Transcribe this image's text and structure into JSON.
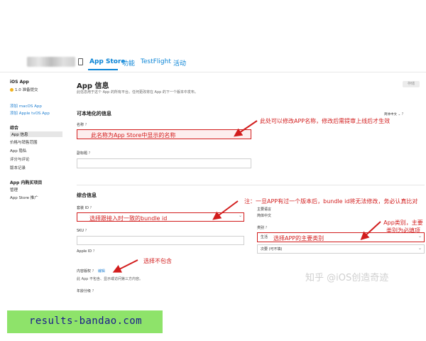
{
  "header": {
    "tabs": [
      {
        "label": "App Store"
      },
      {
        "label": "功能"
      },
      {
        "label": "TestFlight"
      },
      {
        "label": "活动"
      }
    ],
    "save_label": "存储"
  },
  "sidebar": {
    "platform": "iOS App",
    "status": "1.0 准备提交",
    "add_macos": "添加 macOS App",
    "add_tvos": "添加 Apple tvOS App",
    "general_head": "综合",
    "items": [
      "App 信息",
      "价格与销售范围",
      "App 隐私",
      "评分与评论",
      "版本记录"
    ],
    "iap_head": "App 内购买项目",
    "iap_items": [
      "管理",
      "App Store 推广"
    ]
  },
  "main": {
    "title": "App 信息",
    "subtitle": "此信息用于这个 App 的所有平台。任何更改将在 App 的下一个版本中发布。",
    "localizable": {
      "title": "可本地化的信息",
      "lang": "简体中文",
      "name_label": "名称",
      "subtitle_label": "副标题"
    },
    "general": {
      "title": "综合信息",
      "bundle_label": "套装 ID",
      "sku_label": "SKU",
      "appleid_label": "Apple ID",
      "rights_label": "内容版权",
      "rights_value": "编辑",
      "rights_desc": "此 App 不包含、显示或访问第三方内容。",
      "age_label": "年龄分级",
      "primary_lang_label": "主要语言",
      "primary_lang_value": "简体中文",
      "category_label": "类别",
      "category_value": "生活",
      "secondary_value": "次要 (可不填)"
    }
  },
  "annotations": {
    "name_note": "此处可以修改APP名称，修改后需提审上线后才生效",
    "name_box_text": "此名称为App Store中显示的名称",
    "bundle_note": "注：一旦APP有过一个版本后，bundle id将无法修改，务必认真比对",
    "bundle_box_text": "选择跟接入时一致的bundle id",
    "category_note": "App类别，主要类别为必填项",
    "category_box_text": "选择APP的主要类别",
    "rights_note": "选择不包含"
  },
  "watermark": "知乎 @iOS创造奇迹",
  "banner": "results-bandao.com",
  "colors": {
    "accent": "#0a84d6",
    "annotation_red": "#d21d1d",
    "banner_green": "#8ee36a",
    "banner_text": "#1a1a8c"
  }
}
